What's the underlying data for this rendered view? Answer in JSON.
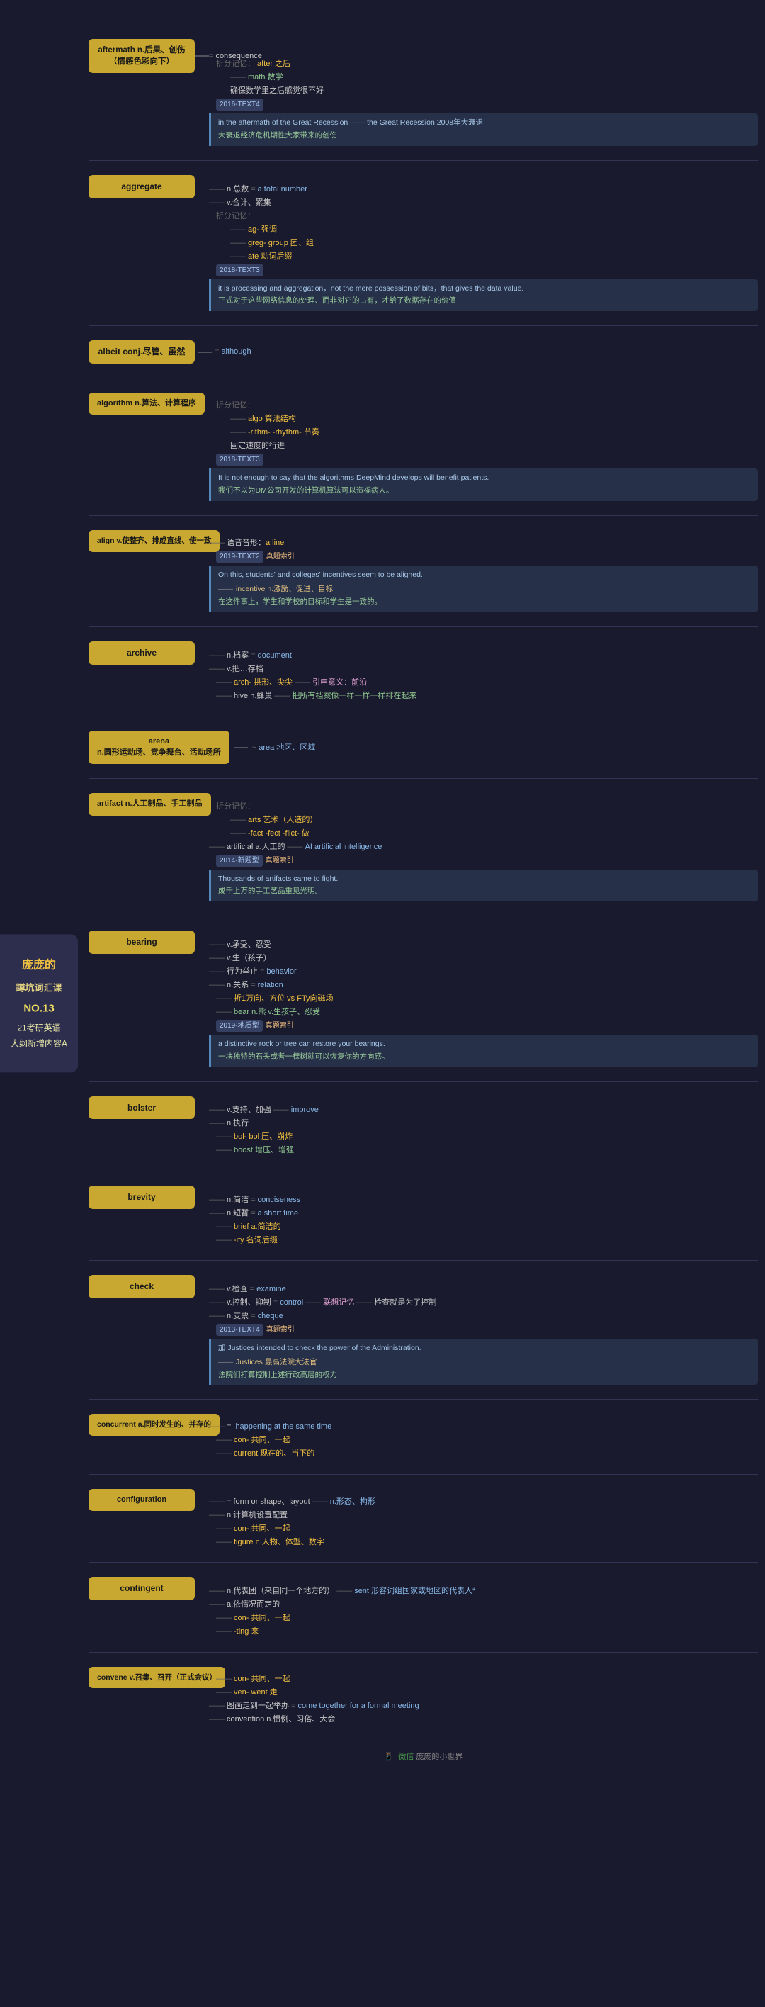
{
  "sidebar": {
    "line1": "庞庞的",
    "line2": "蹲坑词汇课",
    "line3": "NO.13",
    "line4": "21考研英语",
    "line5": "大纲新增内容A"
  },
  "footer": {
    "icon": "微信",
    "text": "庞庞的小世界"
  },
  "words": [
    {
      "id": "aftermath",
      "node_text": "aftermath n.后果、创伤\n（情感色彩向下）",
      "branches": [
        {
          "level": 0,
          "type": "def",
          "text": "= consequence"
        },
        {
          "level": 0,
          "type": "mnemonic",
          "text": "折分记忆：after 之后"
        },
        {
          "level": 1,
          "type": "sub",
          "text": "math 数学"
        },
        {
          "level": 1,
          "type": "cn",
          "text": "确保数学里之后感觉很不好"
        },
        {
          "level": 0,
          "type": "year",
          "text": "2016-TEXT4"
        },
        {
          "level": 0,
          "type": "example",
          "text": "in the aftermath of the Great Recession —— the Great Recession 2008年大衰退"
        },
        {
          "level": 0,
          "type": "cn",
          "text": "大衰退经济危机期性大家带来的创伤"
        }
      ]
    },
    {
      "id": "aggregate",
      "node_text": "aggregate",
      "branches": [
        {
          "level": 0,
          "type": "def",
          "text": "n.总数 = a total number"
        },
        {
          "level": 0,
          "type": "def2",
          "text": "v.合计、累集"
        },
        {
          "level": 0,
          "type": "mnemonic",
          "text": "折分记忆："
        },
        {
          "level": 1,
          "type": "sub",
          "text": "ag- 强调"
        },
        {
          "level": 1,
          "type": "sub",
          "text": "greg- group 团、组"
        },
        {
          "level": 1,
          "type": "sub",
          "text": "ate 动词后缀"
        },
        {
          "level": 0,
          "type": "year",
          "text": "2018-TEXT3"
        },
        {
          "level": 0,
          "type": "example",
          "text": "it is processing and aggregation，not the mere possession of bits，that gives the data value."
        },
        {
          "level": 0,
          "type": "cn",
          "text": "正式对于这些网络信息的处理、而非对它的占有，才给了数据存在的价值"
        }
      ]
    },
    {
      "id": "albeit",
      "node_text": "albeit conj.尽管、虽然",
      "branches": [
        {
          "level": 0,
          "type": "def",
          "text": "= although"
        }
      ]
    },
    {
      "id": "algorithm",
      "node_text": "algorithm n.算法、计算程序",
      "branches": [
        {
          "level": 0,
          "type": "mnemonic",
          "text": "折分记忆："
        },
        {
          "level": 1,
          "type": "sub",
          "text": "algo 算法结构"
        },
        {
          "level": 1,
          "type": "sub",
          "text": "-rithm- -rhythm- 节奏"
        },
        {
          "level": 1,
          "type": "sub",
          "text": "固定速度的行进"
        },
        {
          "level": 0,
          "type": "year",
          "text": "2018-TEXT3"
        },
        {
          "level": 0,
          "type": "example",
          "text": "It is not enough to say that the algorithms DeepMind develops will benefit patients."
        },
        {
          "level": 0,
          "type": "cn",
          "text": "我们不以为DM公司开发的计算机算法可以造福病人。"
        }
      ]
    },
    {
      "id": "align",
      "node_text": "align v.使整齐、排成直线、使一致",
      "branches": [
        {
          "level": 0,
          "type": "mnemonic",
          "text": "语音音形：a line"
        },
        {
          "level": 0,
          "type": "year",
          "text": "2019-TEXT2"
        },
        {
          "level": 0,
          "type": "label",
          "text": "真题索引"
        },
        {
          "level": 0,
          "type": "example",
          "text": "On this, students' and colleges' incentives seem to be aligned."
        },
        {
          "level": 0,
          "type": "arrow",
          "text": "incentive n.激励、促进、目标"
        },
        {
          "level": 0,
          "type": "cn",
          "text": "在这件事上，学生和学校的目标和学生是一致的。"
        }
      ]
    },
    {
      "id": "archive",
      "node_text": "archive",
      "branches": [
        {
          "level": 0,
          "type": "def",
          "text": "n.档案 = document"
        },
        {
          "level": 0,
          "type": "def2",
          "text": "v.把…存档"
        },
        {
          "level": 0,
          "type": "mnemonic",
          "text": "arch- 拱形、尖尖 —— 引申意义：前沿"
        },
        {
          "level": 0,
          "type": "mnemonic2",
          "text": "hive n.蜂巢 —— 把所有档案像一样一样一样排在起来"
        }
      ]
    },
    {
      "id": "arena",
      "node_text": "arena\nn.圆形运动场、竞争舞台、活动场所",
      "branches": [
        {
          "level": 0,
          "type": "def",
          "text": "~ area 地区、区域"
        }
      ]
    },
    {
      "id": "artifact",
      "node_text": "artifact n.人工制品、手工制品",
      "branches": [
        {
          "level": 0,
          "type": "mnemonic",
          "text": "折分记忆："
        },
        {
          "level": 1,
          "type": "sub",
          "text": "arts 艺术（人造的）"
        },
        {
          "level": 1,
          "type": "sub",
          "text": "-fact -fect -flict- 做"
        },
        {
          "level": 0,
          "type": "def2",
          "text": "artificial a.人工的 —— AI artificial intelligence"
        },
        {
          "level": 0,
          "type": "year",
          "text": "2014-新题型"
        },
        {
          "level": 0,
          "type": "label",
          "text": "真题索引"
        },
        {
          "level": 0,
          "type": "example",
          "text": "Thousands of artifacts came to fight."
        },
        {
          "level": 0,
          "type": "cn",
          "text": "成千上万的手工艺品重见光明。"
        }
      ]
    },
    {
      "id": "bearing",
      "node_text": "bearing",
      "branches": [
        {
          "level": 0,
          "type": "def",
          "text": "v.承受、忍受"
        },
        {
          "level": 0,
          "type": "def2",
          "text": "v.生（孩子）"
        },
        {
          "level": 0,
          "type": "def3",
          "text": "行为举止 = behavior"
        },
        {
          "level": 0,
          "type": "def4",
          "text": "n.关系 =relation"
        },
        {
          "level": 0,
          "type": "mnemonic",
          "text": "折1万向、方位 vs FTy向磁场"
        },
        {
          "level": 0,
          "type": "mnemonic2",
          "text": "bear n.熊 v.生孩子、忍受"
        },
        {
          "level": 0,
          "type": "year",
          "text": "2019-地质型"
        },
        {
          "level": 0,
          "type": "label",
          "text": "真题索引"
        },
        {
          "level": 0,
          "type": "example",
          "text": "a distinctive rock or tree can restore your bearings."
        },
        {
          "level": 0,
          "type": "cn",
          "text": "一块独特的石头或者一棵树就可以恢复你的方向感。"
        }
      ]
    },
    {
      "id": "bolster",
      "node_text": "bolster",
      "branches": [
        {
          "level": 0,
          "type": "def",
          "text": "v.支持、加强 —— improve"
        },
        {
          "level": 0,
          "type": "def2",
          "text": "n.执行"
        },
        {
          "level": 0,
          "type": "mnemonic",
          "text": "bol- bol 压、崩炸"
        },
        {
          "level": 0,
          "type": "mnemonic2",
          "text": "boost 增压、增强"
        }
      ]
    },
    {
      "id": "brevity",
      "node_text": "brevity",
      "branches": [
        {
          "level": 0,
          "type": "def",
          "text": "n.简洁 = conciseness"
        },
        {
          "level": 0,
          "type": "def2",
          "text": "n.短暂 = a short time"
        },
        {
          "level": 0,
          "type": "mnemonic",
          "text": "brief a.简洁的"
        },
        {
          "level": 0,
          "type": "mnemonic2",
          "text": "-ity 名词后缀"
        }
      ]
    },
    {
      "id": "check",
      "node_text": "check",
      "branches": [
        {
          "level": 0,
          "type": "def",
          "text": "v.检查 = examine"
        },
        {
          "level": 0,
          "type": "def2",
          "text": "v.控制、抑制 = control —— 联想记忆 —— 检查就是为了控制"
        },
        {
          "level": 0,
          "type": "def3",
          "text": "n.支票 = cheque"
        },
        {
          "level": 0,
          "type": "year",
          "text": "2013-TEXT4"
        },
        {
          "level": 0,
          "type": "label",
          "text": "真题索引"
        },
        {
          "level": 0,
          "type": "example",
          "text": "加 Justices intended to check the power of the Administration."
        },
        {
          "level": 0,
          "type": "cn",
          "text": "Justices 最高法院大法官"
        },
        {
          "level": 0,
          "type": "cn2",
          "text": "法院们打算控制上述行政高层的权力"
        }
      ]
    },
    {
      "id": "concurrent",
      "node_text": "concurrent a.同时发生的、并存的",
      "branches": [
        {
          "level": 0,
          "type": "def",
          "text": "= happening at the same time"
        },
        {
          "level": 0,
          "type": "mnemonic",
          "text": "con- 共同、一起"
        },
        {
          "level": 0,
          "type": "mnemonic2",
          "text": "current 现在的、当下的"
        }
      ]
    },
    {
      "id": "configuration",
      "node_text": "configuration",
      "branches": [
        {
          "level": 0,
          "type": "def",
          "text": "= form or shape、layout —— n.形态、构形"
        },
        {
          "level": 0,
          "type": "def2",
          "text": "n.计算机设置配置"
        },
        {
          "level": 0,
          "type": "mnemonic",
          "text": "con- 共同、一起"
        },
        {
          "level": 0,
          "type": "mnemonic2",
          "text": "figure n.人物、体型、数字"
        }
      ]
    },
    {
      "id": "contingent",
      "node_text": "contingent",
      "branches": [
        {
          "level": 0,
          "type": "def",
          "text": "n.代表团（来自同一个地方的） —— sent 形容词组国家或地区的代表人*"
        },
        {
          "level": 0,
          "type": "def2",
          "text": "a.依情况而定的"
        },
        {
          "level": 0,
          "type": "mnemonic",
          "text": "con- 共同、一起"
        },
        {
          "level": 0,
          "type": "mnemonic2",
          "text": "-ting 来"
        }
      ]
    },
    {
      "id": "convene",
      "node_text": "convene v.召集、召开（正式会议）",
      "branches": [
        {
          "level": 0,
          "type": "mnemonic",
          "text": "con- 共同、一起"
        },
        {
          "level": 0,
          "type": "mnemonic2",
          "text": "ven- went 走"
        },
        {
          "level": 0,
          "type": "def",
          "text": "图画走到一起举办 = come together for a formal meeting"
        },
        {
          "level": 0,
          "type": "def2",
          "text": "convention n.惯例、习俗、大会"
        }
      ]
    }
  ]
}
